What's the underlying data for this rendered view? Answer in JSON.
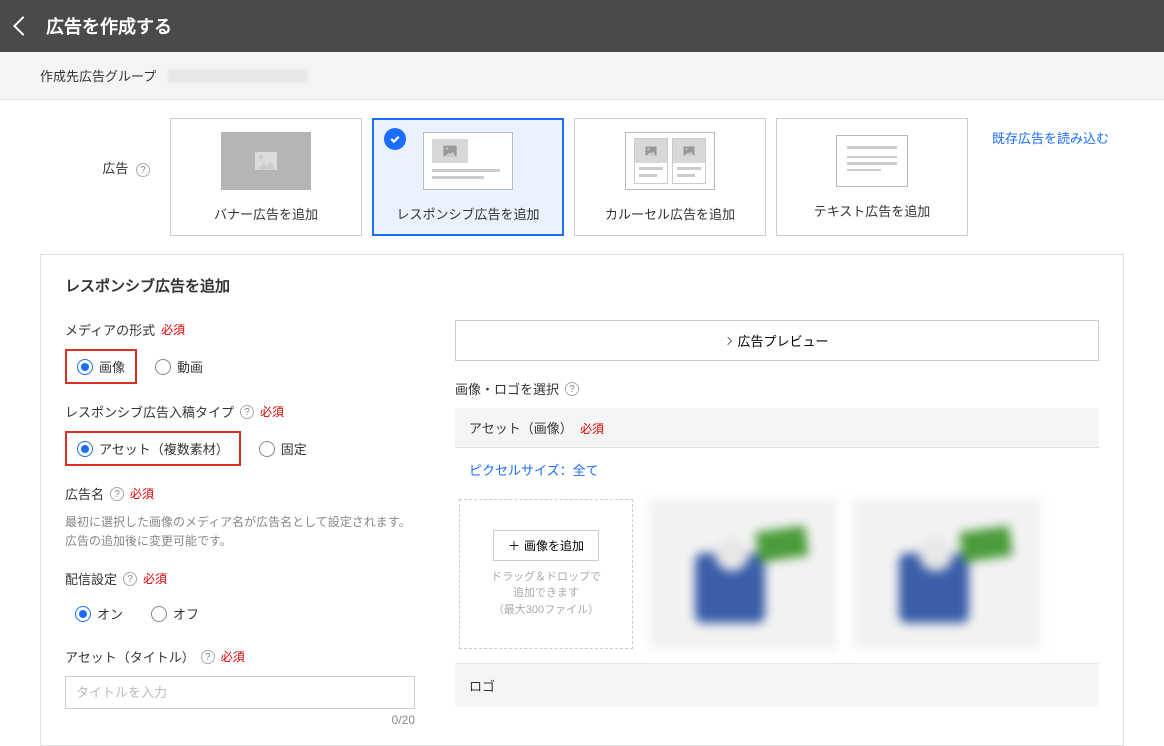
{
  "topbar": {
    "title": "広告を作成する"
  },
  "groupbar": {
    "label": "作成先広告グループ"
  },
  "ad": {
    "section_label": "広告",
    "types": {
      "banner": "バナー広告を追加",
      "responsive": "レスポンシブ広告を追加",
      "carousel": "カルーセル広告を追加",
      "text": "テキスト広告を追加"
    },
    "load_existing": "既存広告を読み込む"
  },
  "panel": {
    "title": "レスポンシブ広告を追加",
    "media_format": {
      "label": "メディアの形式",
      "required": "必須",
      "image": "画像",
      "video": "動画"
    },
    "input_type": {
      "label": "レスポンシブ広告入稿タイプ",
      "required": "必須",
      "asset": "アセット（複数素材）",
      "fixed": "固定"
    },
    "ad_name": {
      "label": "広告名",
      "required": "必須",
      "desc": "最初に選択した画像のメディア名が広告名として設定されます。広告の追加後に変更可能です。"
    },
    "delivery": {
      "label": "配信設定",
      "required": "必須",
      "on": "オン",
      "off": "オフ"
    },
    "asset_title": {
      "label": "アセット（タイトル）",
      "required": "必須",
      "placeholder": "タイトルを入力",
      "count": "0/20"
    },
    "preview_btn": "広告プレビュー",
    "image_section": "画像・ロゴを選択",
    "asset_tab": {
      "label": "アセット（画像）",
      "required": "必須"
    },
    "pixel_link": "ピクセルサイズ：全て",
    "upload": {
      "btn": "画像を追加",
      "hint1": "ドラッグ＆ドロップで",
      "hint2": "追加できます",
      "hint3": "（最大300ファイル）"
    },
    "logo_label": "ロゴ"
  }
}
